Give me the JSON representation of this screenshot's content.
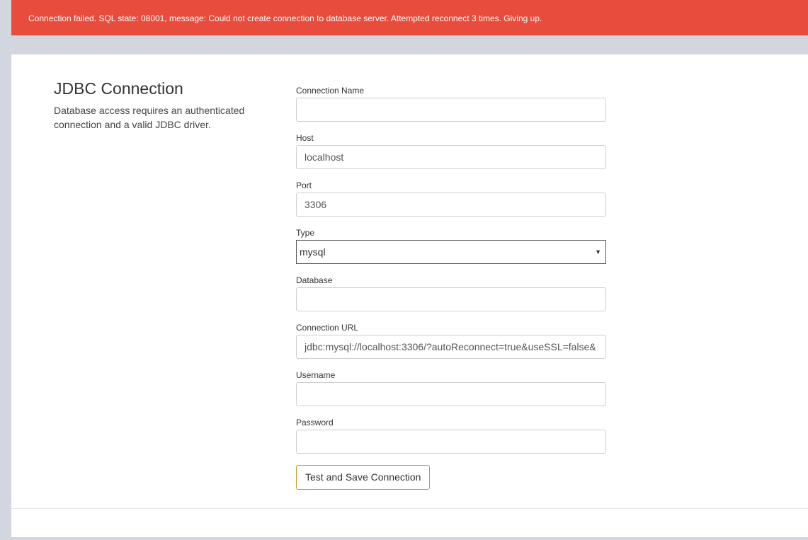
{
  "alert": {
    "message": "Connection failed. SQL state: 08001, message: Could not create connection to database server. Attempted reconnect 3 times. Giving up."
  },
  "intro": {
    "title": "JDBC Connection",
    "description": "Database access requires an authenticated connection and a valid JDBC driver."
  },
  "form": {
    "connection_name": {
      "label": "Connection Name",
      "value": ""
    },
    "host": {
      "label": "Host",
      "value": "localhost"
    },
    "port": {
      "label": "Port",
      "value": "3306"
    },
    "type": {
      "label": "Type",
      "value": "mysql"
    },
    "database": {
      "label": "Database",
      "value": ""
    },
    "connection_url": {
      "label": "Connection URL",
      "value": "jdbc:mysql://localhost:3306/?autoReconnect=true&useSSL=false&"
    },
    "username": {
      "label": "Username",
      "value": ""
    },
    "password": {
      "label": "Password",
      "value": ""
    },
    "submit_label": "Test and Save Connection"
  },
  "colors": {
    "alert_bg": "#e74c3c",
    "page_bg": "#d2d6de",
    "button_border": "#c99a27"
  }
}
